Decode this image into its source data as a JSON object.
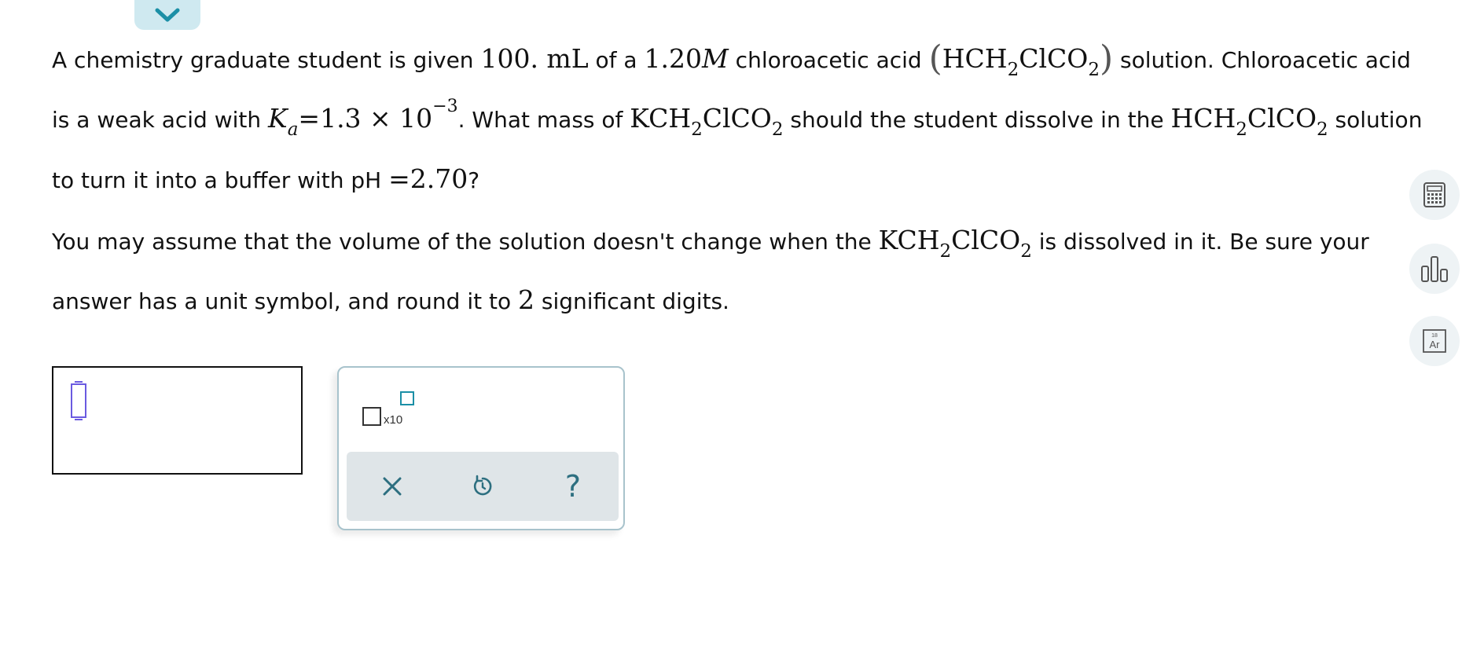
{
  "header": {
    "collapse_icon": "chevron-down-icon"
  },
  "question": {
    "p1": {
      "t1": "A chemistry graduate student is given ",
      "volume": "100. mL",
      "t2": " of a ",
      "conc_value": "1.20",
      "conc_unit": "M",
      "t3": " chloroacetic acid ",
      "f1_a": "HCH",
      "f1_s1": "2",
      "f1_b": "ClCO",
      "f1_s2": "2",
      "t4": " solution. Chloroacetic acid is a weak acid with ",
      "ka_k": "K",
      "ka_sub": "a",
      "ka_eq": "=1.3 × 10",
      "ka_exp": "−3",
      "t5": ". What mass of ",
      "f2_a": "KCH",
      "f2_s1": "2",
      "f2_b": "ClCO",
      "f2_s2": "2",
      "t6": " should the student dissolve in the ",
      "f3_a": "HCH",
      "f3_s1": "2",
      "f3_b": "ClCO",
      "f3_s2": "2",
      "t7": " solution to turn it into a buffer with pH ",
      "ph_val": "=2.70",
      "t8": "?"
    },
    "p2": {
      "t1": "You may assume that the volume of the solution doesn't change when the ",
      "f_a": "KCH",
      "f_s1": "2",
      "f_b": "ClCO",
      "f_s2": "2",
      "t2": " is dissolved in it. Be sure your answer has a unit symbol, and round it to ",
      "digits": "2",
      "t3": " significant digits."
    }
  },
  "tools": {
    "calculator_icon": "calculator-icon",
    "data_icon": "bar-chart-icon",
    "periodic_icon": "periodic-table-icon",
    "periodic_number": "18",
    "periodic_symbol": "Ar"
  },
  "keypad": {
    "sci_label": "x10",
    "clear_icon": "close-icon",
    "undo_icon": "undo-icon",
    "help_icon": "help-icon",
    "help_glyph": "?"
  },
  "colors": {
    "accent": "#1b8fa6",
    "tab_bg": "#cfe9f0",
    "cursor": "#6a5ae0",
    "toolbar_bg": "#dfe5e8"
  }
}
